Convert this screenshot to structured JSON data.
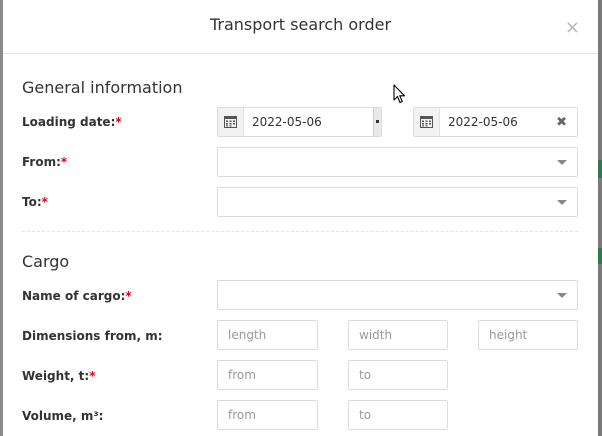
{
  "modal": {
    "title": "Transport search order",
    "close_label": "×"
  },
  "general": {
    "section_title": "General information",
    "loading_date_label": "Loading date:",
    "date_from_value": "2022-05-06",
    "date_to_value": "2022-05-06",
    "from_label": "From:",
    "to_label": "To:",
    "required_mark": "*"
  },
  "cargo": {
    "section_title": "Cargo",
    "name_label": "Name of cargo:",
    "dimensions_label": "Dimensions from, m:",
    "length_placeholder": "length",
    "width_placeholder": "width",
    "height_placeholder": "height",
    "weight_label": "Weight, t:",
    "weight_from_placeholder": "from",
    "weight_to_placeholder": "to",
    "volume_label": "Volume, m³:",
    "volume_from_placeholder": "from",
    "volume_to_placeholder": "to"
  },
  "icons": {
    "calendar": "calendar-icon",
    "clear": "clear-icon",
    "dropdown": "chevron-down-icon",
    "cursor": "mouse-cursor-icon"
  }
}
